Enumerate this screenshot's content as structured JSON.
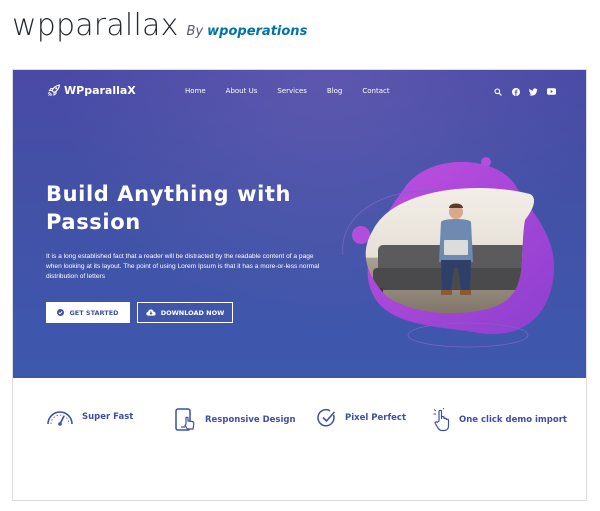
{
  "theme": {
    "name": "wpparallax",
    "by_label": "By",
    "author": "wpoperations"
  },
  "preview": {
    "nav": {
      "logo_text": "WPparallaX",
      "items": [
        {
          "label": "Home"
        },
        {
          "label": "About Us"
        },
        {
          "label": "Services"
        },
        {
          "label": "Blog"
        },
        {
          "label": "Contact"
        }
      ],
      "icons": [
        "search-icon",
        "facebook-icon",
        "twitter-icon",
        "youtube-icon"
      ]
    },
    "hero": {
      "title": "Build Anything with Passion",
      "text": "It is a long established fact that a reader will be distracted by the readable content of a page when looking at its layout. The point of using Lorem Ipsum is that it has a more-or-less normal distribution of letters",
      "primary_button": "GET STARTED",
      "secondary_button": "DOWNLOAD NOW",
      "image": "man-on-couch-with-laptop"
    },
    "features": [
      {
        "label": "Super Fast",
        "icon": "speedometer-icon"
      },
      {
        "label": "Responsive Design",
        "icon": "tablet-touch-icon"
      },
      {
        "label": "Pixel Perfect",
        "icon": "check-circle-icon"
      },
      {
        "label": "One click demo import",
        "icon": "pointer-hand-icon"
      }
    ],
    "colors": {
      "hero_background": "#4251a6",
      "accent": "#3f4fa8",
      "blob": "#a44ad8",
      "author_link": "#0073aa"
    }
  }
}
